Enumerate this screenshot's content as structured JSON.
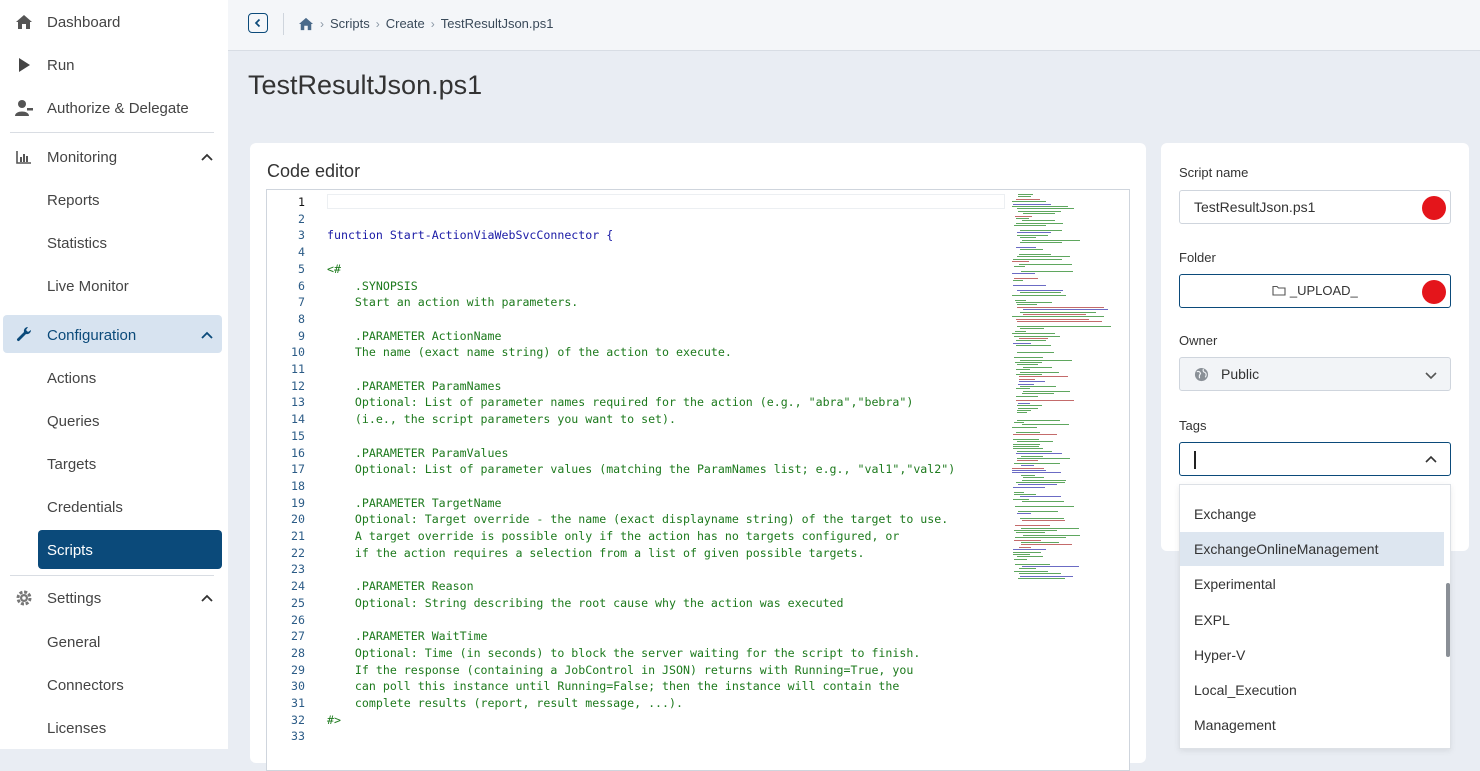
{
  "sidebar": {
    "items": [
      {
        "label": "Dashboard",
        "icon": "home-icon"
      },
      {
        "label": "Run",
        "icon": "play-icon"
      },
      {
        "label": "Authorize & Delegate",
        "icon": "user-key-icon"
      }
    ],
    "monitoring": {
      "label": "Monitoring",
      "icon": "chart-icon",
      "children": [
        "Reports",
        "Statistics",
        "Live Monitor"
      ]
    },
    "configuration": {
      "label": "Configuration",
      "icon": "wrench-icon",
      "children": [
        "Actions",
        "Queries",
        "Targets",
        "Credentials",
        "Scripts"
      ]
    },
    "settings": {
      "label": "Settings",
      "icon": "gear-icon",
      "children": [
        "General",
        "Connectors",
        "Licenses"
      ]
    }
  },
  "breadcrumb": [
    "Scripts",
    "Create",
    "TestResultJson.ps1"
  ],
  "page_title": "TestResultJson.ps1",
  "editor": {
    "title": "Code editor",
    "lines": [
      {
        "n": "1",
        "text": ""
      },
      {
        "n": "2",
        "text": ""
      },
      {
        "n": "3",
        "text": "function Start-ActionViaWebSvcConnector {"
      },
      {
        "n": "4",
        "text": ""
      },
      {
        "n": "5",
        "text": "<#"
      },
      {
        "n": "6",
        "text": "    .SYNOPSIS"
      },
      {
        "n": "7",
        "text": "    Start an action with parameters."
      },
      {
        "n": "8",
        "text": ""
      },
      {
        "n": "9",
        "text": "    .PARAMETER ActionName"
      },
      {
        "n": "10",
        "text": "    The name (exact name string) of the action to execute."
      },
      {
        "n": "11",
        "text": ""
      },
      {
        "n": "12",
        "text": "    .PARAMETER ParamNames"
      },
      {
        "n": "13",
        "text": "    Optional: List of parameter names required for the action (e.g., \"abra\",\"bebra\")"
      },
      {
        "n": "14",
        "text": "    (i.e., the script parameters you want to set)."
      },
      {
        "n": "15",
        "text": ""
      },
      {
        "n": "16",
        "text": "    .PARAMETER ParamValues"
      },
      {
        "n": "17",
        "text": "    Optional: List of parameter values (matching the ParamNames list; e.g., \"val1\",\"val2\")"
      },
      {
        "n": "18",
        "text": ""
      },
      {
        "n": "19",
        "text": "    .PARAMETER TargetName"
      },
      {
        "n": "20",
        "text": "    Optional: Target override - the name (exact displayname string) of the target to use."
      },
      {
        "n": "21",
        "text": "    A target override is possible only if the action has no targets configured, or"
      },
      {
        "n": "22",
        "text": "    if the action requires a selection from a list of given possible targets."
      },
      {
        "n": "23",
        "text": ""
      },
      {
        "n": "24",
        "text": "    .PARAMETER Reason"
      },
      {
        "n": "25",
        "text": "    Optional: String describing the root cause why the action was executed"
      },
      {
        "n": "26",
        "text": ""
      },
      {
        "n": "27",
        "text": "    .PARAMETER WaitTime"
      },
      {
        "n": "28",
        "text": "    Optional: Time (in seconds) to block the server waiting for the script to finish."
      },
      {
        "n": "29",
        "text": "    If the response (containing a JobControl in JSON) returns with Running=True, you"
      },
      {
        "n": "30",
        "text": "    can poll this instance until Running=False; then the instance will contain the"
      },
      {
        "n": "31",
        "text": "    complete results (report, result message, ...)."
      },
      {
        "n": "32",
        "text": "#>"
      },
      {
        "n": "33",
        "text": ""
      }
    ]
  },
  "properties": {
    "script_name_label": "Script name",
    "script_name_value": "TestResultJson.ps1",
    "folder_label": "Folder",
    "folder_value": "_UPLOAD_",
    "owner_label": "Owner",
    "owner_value": "Public",
    "tags_label": "Tags",
    "tags_value": ""
  },
  "tags_dropdown": {
    "options": [
      "Exchange",
      "ExchangeOnlineManagement",
      "Experimental",
      "EXPL",
      "Hyper-V",
      "Local_Execution",
      "Management"
    ],
    "highlighted": "ExchangeOnlineManagement"
  },
  "colors": {
    "accent": "#0b4a7a",
    "active_bg": "#d7e3f0",
    "status_red": "#e4151b",
    "comment_green": "#1d7a1d",
    "keyword_blue": "#1a1aa6"
  }
}
